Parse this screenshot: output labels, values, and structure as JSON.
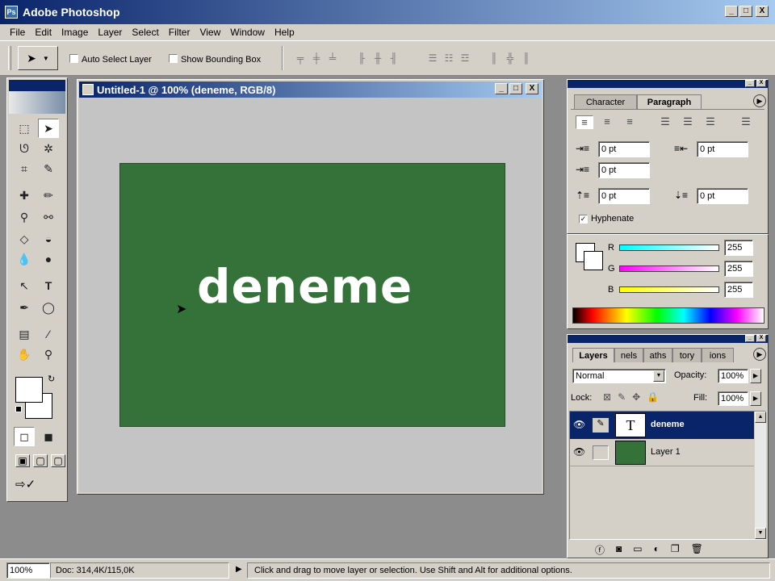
{
  "app": {
    "title": "Adobe Photoshop",
    "icon": "ps-app-icon"
  },
  "window_controls": {
    "minimize": "_",
    "maximize": "□",
    "close": "X"
  },
  "menu": [
    "File",
    "Edit",
    "Image",
    "Layer",
    "Select",
    "Filter",
    "View",
    "Window",
    "Help"
  ],
  "options_bar": {
    "auto_select_label": "Auto Select Layer",
    "auto_select_checked": false,
    "show_bounding_label": "Show Bounding Box",
    "show_bounding_checked": false
  },
  "document": {
    "title": "Untitled-1 @ 100% (deneme, RGB/8)",
    "canvas_color": "#35723a",
    "text": "deneme"
  },
  "paragraph_panel": {
    "tabs": [
      "Character",
      "Paragraph"
    ],
    "active_tab": "Paragraph",
    "indent_left": "0 pt",
    "indent_right": "0 pt",
    "first_line": "0 pt",
    "space_before": "0 pt",
    "space_after": "0 pt",
    "hyphenate_label": "Hyphenate",
    "hyphenate_checked": true
  },
  "color_panel": {
    "r_label": "R",
    "r_value": "255",
    "g_label": "G",
    "g_value": "255",
    "b_label": "B",
    "b_value": "255"
  },
  "layers_panel": {
    "tabs": [
      "Layers",
      "nels",
      "aths",
      "tory",
      "ions"
    ],
    "blend_mode": "Normal",
    "opacity_label": "Opacity:",
    "opacity_value": "100%",
    "lock_label": "Lock:",
    "fill_label": "Fill:",
    "fill_value": "100%",
    "layers": [
      {
        "name": "deneme",
        "type": "text",
        "thumb": "T",
        "selected": true
      },
      {
        "name": "Layer 1",
        "type": "raster",
        "thumb": "",
        "selected": false
      }
    ]
  },
  "status_bar": {
    "zoom": "100%",
    "doc_size": "Doc: 314,4K/115,0K",
    "hint": "Click and drag to move layer or selection.  Use Shift and Alt for additional options."
  },
  "colors": {
    "titlebar_start": "#0a246a",
    "titlebar_end": "#a6caf0",
    "chrome": "#d4d0c8",
    "selection": "#0a246a"
  }
}
